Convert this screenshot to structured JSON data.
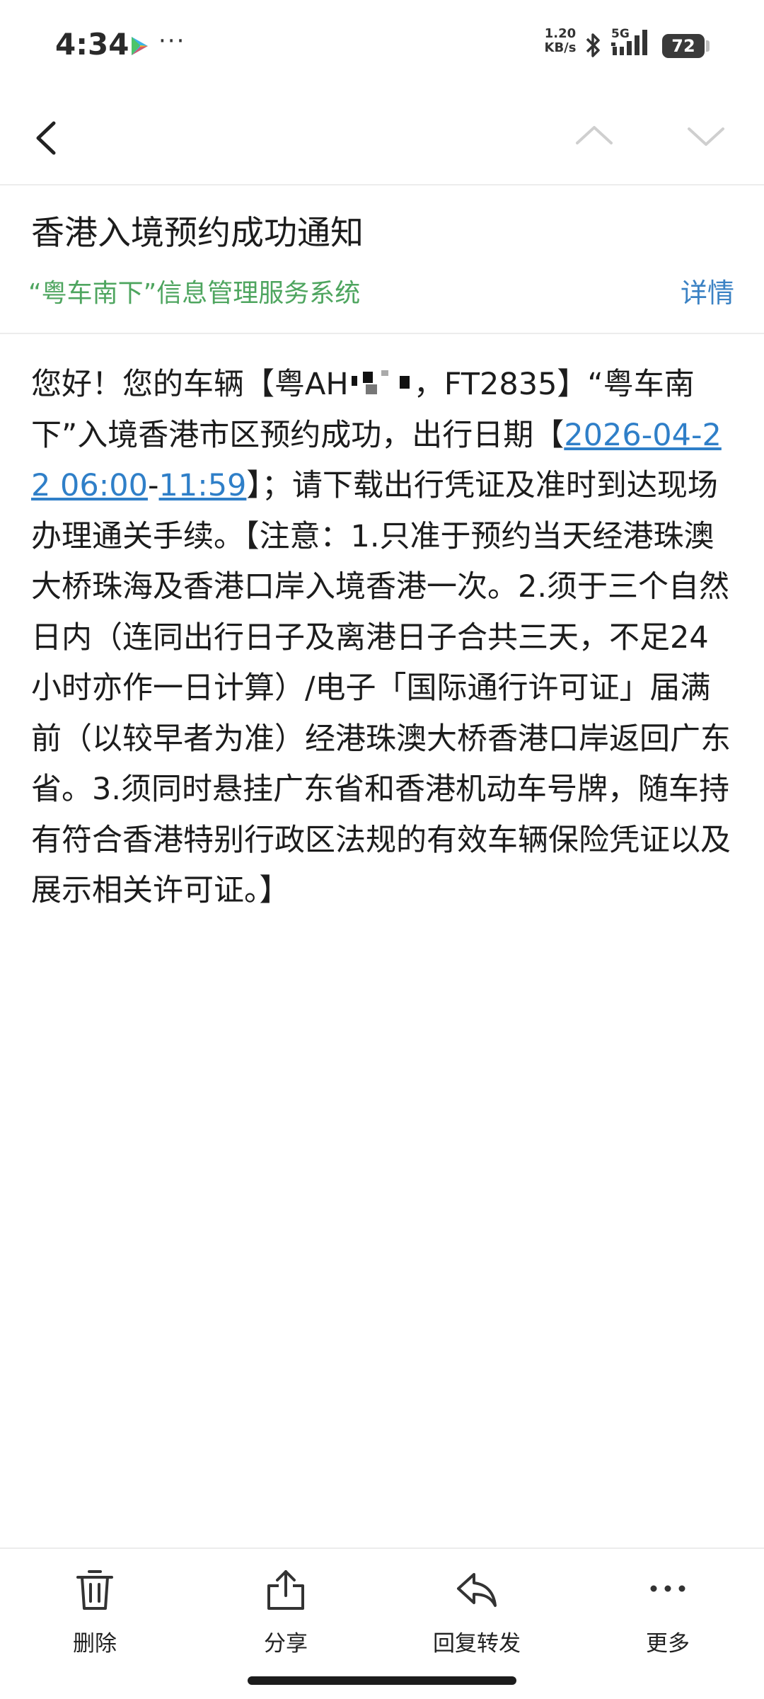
{
  "status_bar": {
    "time": "4:34",
    "dots": "···",
    "net_speed_value": "1.20",
    "net_speed_unit": "KB/s",
    "network": "5G",
    "battery": "72",
    "icons": [
      "play-store-icon",
      "bluetooth-icon",
      "signal-icon",
      "battery-icon"
    ]
  },
  "nav": {
    "back_icon": "chevron-left-icon",
    "prev_icon": "chevron-up-icon",
    "next_icon": "chevron-down-icon"
  },
  "mail": {
    "subject": "香港入境预约成功通知",
    "sender": "“粤车南下”信息管理服务系统",
    "details_label": "详情",
    "body": {
      "part1": "您好！您的车辆【粤AH",
      "part2": "，FT2835】“粤车南下”入境香港市区预约成功，出行日期【",
      "link_start": "2026-04-22 06:00",
      "dash": "-",
      "link_end": "11:59",
      "part3": "】；请下载出行凭证及准时到达现场办理通关手续。【注意：1.只准于预约当天经港珠澳大桥珠海及香港口岸入境香港一次。2.须于三个自然日内（连同出行日子及离港日子合共三天，不足24小时亦作一日计算）/电子「国际通行许可证」届满前（以较早者为准）经港珠澳大桥香港口岸返回广东省。3.须同时悬挂广东省和香港机动车号牌，随车持有符合香港特别行政区法规的有效车辆保险凭证以及展示相关许可证。】"
    }
  },
  "toolbar": {
    "delete_label": "删除",
    "share_label": "分享",
    "reply_forward_label": "回复转发",
    "more_label": "更多"
  },
  "colors": {
    "sender_green": "#4ea55f",
    "link_blue": "#2f7fc8",
    "details_blue": "#3b82c4"
  }
}
